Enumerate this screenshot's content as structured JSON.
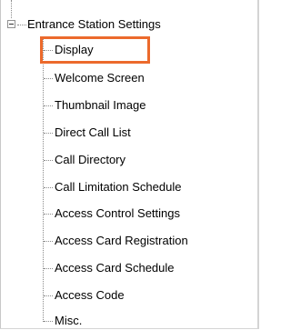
{
  "tree": {
    "root": {
      "label": "Entrance Station Settings",
      "expanded": true,
      "expander_glyph": "minus-box-icon"
    },
    "children": [
      {
        "label": "Display",
        "highlighted": true
      },
      {
        "label": "Welcome Screen"
      },
      {
        "label": "Thumbnail Image"
      },
      {
        "label": "Direct Call List"
      },
      {
        "label": "Call Directory"
      },
      {
        "label": "Call Limitation Schedule"
      },
      {
        "label": "Access Control Settings"
      },
      {
        "label": "Access Card Registration"
      },
      {
        "label": "Access Card Schedule"
      },
      {
        "label": "Access Code"
      },
      {
        "label": "Misc."
      }
    ]
  },
  "colors": {
    "highlight_border": "#ec6a2c",
    "connector": "#8a8a8a",
    "background": "#ffffff"
  }
}
